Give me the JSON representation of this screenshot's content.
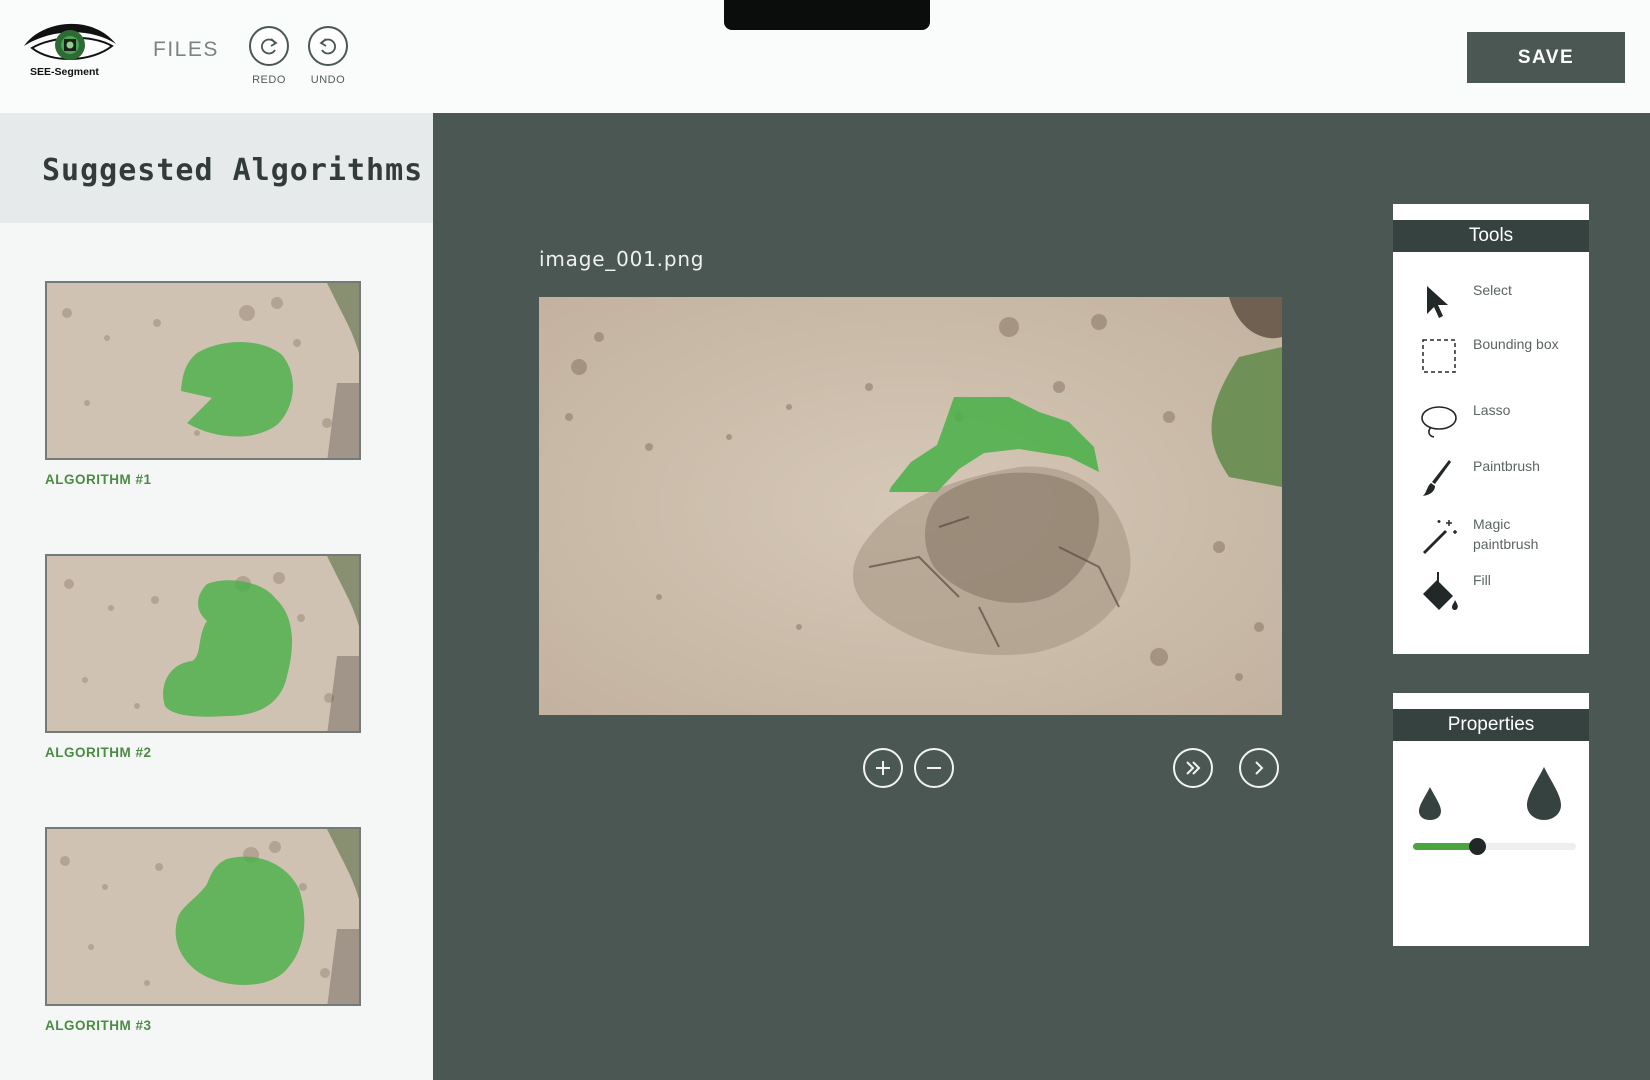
{
  "header": {
    "logo_text": "SEE-Segment",
    "files_label": "FILES",
    "redo_label": "REDO",
    "undo_label": "UNDO",
    "save_label": "SAVE"
  },
  "sidebar": {
    "title": "Suggested Algorithms",
    "algorithms": [
      {
        "label": "ALGORITHM #1"
      },
      {
        "label": "ALGORITHM #2"
      },
      {
        "label": "ALGORITHM #3"
      }
    ]
  },
  "canvas": {
    "file_name": "image_001.png",
    "controls": [
      "zoom-in-icon",
      "zoom-out-icon",
      "fast-forward-icon",
      "next-icon"
    ]
  },
  "tools": {
    "title": "Tools",
    "items": [
      {
        "label": "Select",
        "icon": "cursor-icon"
      },
      {
        "label": "Bounding box",
        "icon": "bounding-box-icon"
      },
      {
        "label": "Lasso",
        "icon": "lasso-icon"
      },
      {
        "label": "Paintbrush",
        "icon": "paintbrush-icon"
      },
      {
        "label": "Magic paintbrush",
        "icon": "magic-wand-icon"
      },
      {
        "label": "Fill",
        "icon": "paint-bucket-icon"
      }
    ]
  },
  "properties": {
    "title": "Properties",
    "brush_size_fraction": 0.39
  },
  "colors": {
    "accent_dark": "#4a5753",
    "panel_header": "#36423f",
    "segment_green": "#4cb04a",
    "label_green": "#4b8b43"
  }
}
